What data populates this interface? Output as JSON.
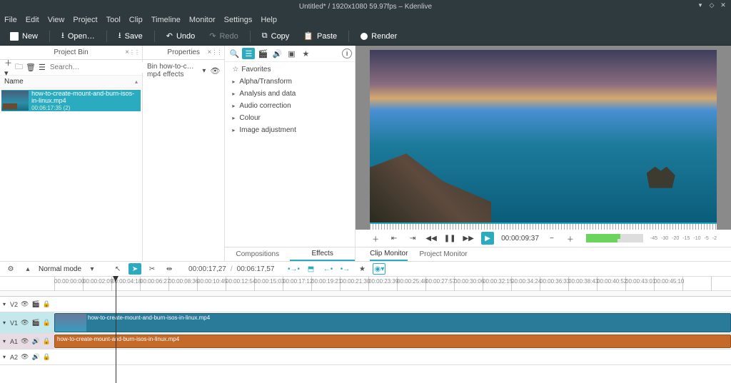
{
  "window": {
    "title": "Untitled* / 1920x1080 59.97fps – Kdenlive"
  },
  "menubar": [
    "File",
    "Edit",
    "View",
    "Project",
    "Tool",
    "Clip",
    "Timeline",
    "Monitor",
    "Settings",
    "Help"
  ],
  "toolbar": {
    "new": "New",
    "open": "Open…",
    "save": "Save",
    "undo": "Undo",
    "redo": "Redo",
    "copy": "Copy",
    "paste": "Paste",
    "render": "Render"
  },
  "project_bin": {
    "title": "Project Bin",
    "search_placeholder": "Search…",
    "name_col": "Name",
    "items": [
      {
        "name": "how-to-create-mount-and-burn-isos-in-linux.mp4",
        "duration": "00:06:17:35 (2)"
      }
    ]
  },
  "properties": {
    "title": "Properties",
    "text": "Bin how-to-c…mp4 effects"
  },
  "effects": {
    "categories": [
      "Favorites",
      "Alpha/Transform",
      "Analysis and data",
      "Audio correction",
      "Colour",
      "Image adjustment"
    ],
    "tabs": {
      "comp": "Compositions",
      "eff": "Effects"
    }
  },
  "monitor": {
    "playhead": "00:00:09:37",
    "scale": [
      "-45",
      "-30",
      "-20",
      "-15",
      "-10",
      "-5",
      "-2"
    ],
    "tabs": {
      "clip": "Clip Monitor",
      "project": "Project Monitor"
    }
  },
  "tl_toolbar": {
    "mode": "Normal mode",
    "tc_in": "00:00:17,27",
    "tc_out": "00:06:17,57"
  },
  "ruler": [
    "00:00:00:00",
    "00:00:02:09",
    "00:00:04:18",
    "00:00:06:27",
    "00:00:08:36",
    "00:00:10:45",
    "00:00:12:54",
    "00:00:15:03",
    "00:00:17:12",
    "00:00:19:21",
    "00:00:21:30",
    "00:00:23:39",
    "00:00:25:48",
    "00:00:27:57",
    "00:00:30:06",
    "00:00:32:15",
    "00:00:34:24",
    "00:00:36:33",
    "00:00:38:43",
    "00:00:40:52",
    "00:00:43:01",
    "00:00:45:10"
  ],
  "tracks": {
    "v2": "V2",
    "v1": "V1",
    "a1": "A1",
    "a2": "A2",
    "clip_video": "how-to-create-mount-and-burn-isos-in-linux.mp4",
    "clip_audio": "how-to-create-mount-and-burn-isos-in-linux.mp4"
  }
}
